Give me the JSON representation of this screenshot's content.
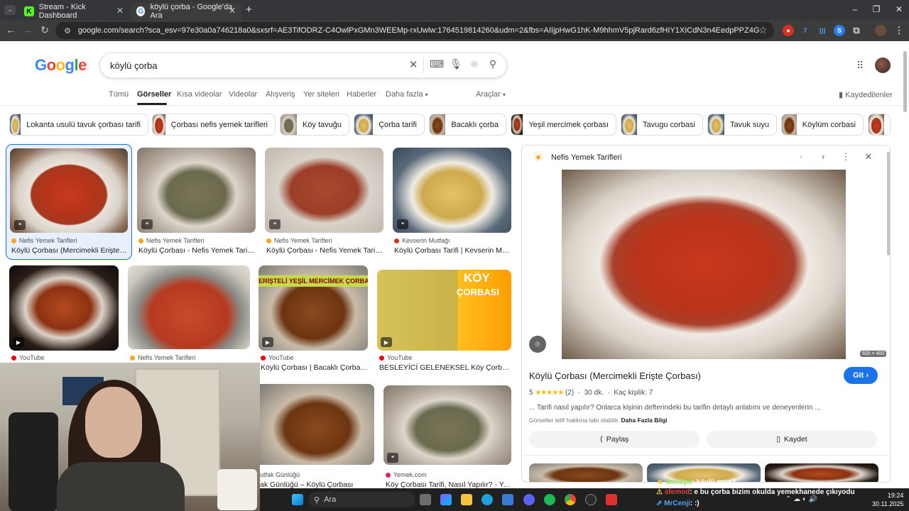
{
  "browser": {
    "tabs": [
      {
        "title": "Stream - Kick Dashboard",
        "active": false
      },
      {
        "title": "köylü çorba - Google'da Ara",
        "active": true
      }
    ],
    "new_tab": "+",
    "url": "google.com/search?sca_esv=97e30a0a746218a0&sxsrf=AE3TifODRZ-C4OwlPxGMn3WEEMp-rxUwlw:1764519814260&udm=2&fbs=AIIjpHwG1hK-M9hhmV5pjRard6zfHIY1XICdN3n4EedpPPZ4GKc20voTBumvheiMxvP_yJBi77HrmN_k..."
  },
  "google": {
    "logo": [
      "G",
      "o",
      "o",
      "g",
      "l",
      "e"
    ],
    "query": "köylü çorba",
    "nav": {
      "tabs": [
        "Tümü",
        "Görseller",
        "Kısa videolar",
        "Videolar",
        "Alışveriş",
        "Yer siteleri",
        "Haberler",
        "Daha fazla"
      ],
      "tools": "Araçlar",
      "saved": "Kaydedilenler"
    },
    "chips": [
      "Lokanta usulü tavuk çorbası tarifi",
      "Çorbası nefis yemek tarifleri",
      "Köy tavuğu",
      "Çorba tarifi",
      "Bacaklı çorba",
      "Yeşil mercimek çorbası",
      "Tavugu corbasi",
      "Tavuk suyu",
      "Köylüm corbasi"
    ],
    "results": [
      {
        "source": "Nefis Yemek Tarifleri",
        "title": "Köylü Çorbası (Mercimekli Erişte Ç..."
      },
      {
        "source": "Nefis Yemek Tarifleri",
        "title": "Köylü Çorbası - Nefis Yemek Tarifleri"
      },
      {
        "source": "Nefis Yemek Tarifleri",
        "title": "Köylü Çorbası - Nefis Yemek Tarifle..."
      },
      {
        "source": "Kevserin Mutfağı",
        "title": "Köylü Çorbası Tarifi | Kevserin Mutf..."
      },
      {
        "source": "YouTube",
        "title": ""
      },
      {
        "source": "Nefis Yemek Tarifleri",
        "title": ""
      },
      {
        "source": "YouTube",
        "title": "Köylü Çorbası | Bacaklı Çorba ..."
      },
      {
        "source": "YouTube",
        "title": "BESLEYİCİ GELENEKSEL Köy Çorbası ..."
      },
      {
        "source": "utfak Günlüğü",
        "title": "ak Günlüğü – Köylü Çorbası"
      },
      {
        "source": "Yemek.com",
        "title": "Köy Çorbası Tarifi, Nasıl Yapılır? - Ye..."
      }
    ],
    "overlay_text": {
      "koy": "KÖY",
      "corbasi": "ÇORBASI",
      "mercimek": "ERİŞTELİ YEŞİL MERCİMEK ÇORBASI"
    }
  },
  "panel": {
    "source": "Nefis Yemek Tarifleri",
    "title": "Köylü Çorbası (Mercimekli Erişte Çorbası)",
    "go": "Git",
    "rating_value": "5",
    "stars": "★★★★★",
    "rating_count": "(2)",
    "time": "30 dk.",
    "servings": "Kaç kişilik: 7",
    "description": "... Tarifi nasıl yapılır? Onlarca kişinin defterindeki bu tarifin detaylı anlatımı ve deneyenlerin ...",
    "copyright": "Görseller telif hakkına tabi olabilir.",
    "more_info": "Daha Fazla Bilgi",
    "share": "Paylaş",
    "save": "Kaydet",
    "dimensions": "600 × 400"
  },
  "taskbar": {
    "search": "Ara",
    "time": "19:24",
    "date": "30.11.2025"
  },
  "chat": [
    {
      "user": "lbellepe",
      "message": "köylü mus?"
    },
    {
      "user": "sfemod",
      "message": "e bu çorba bizim okulda yemekhanede çıkıyodu"
    },
    {
      "user": "MrCenji",
      "message": ":)"
    }
  ]
}
